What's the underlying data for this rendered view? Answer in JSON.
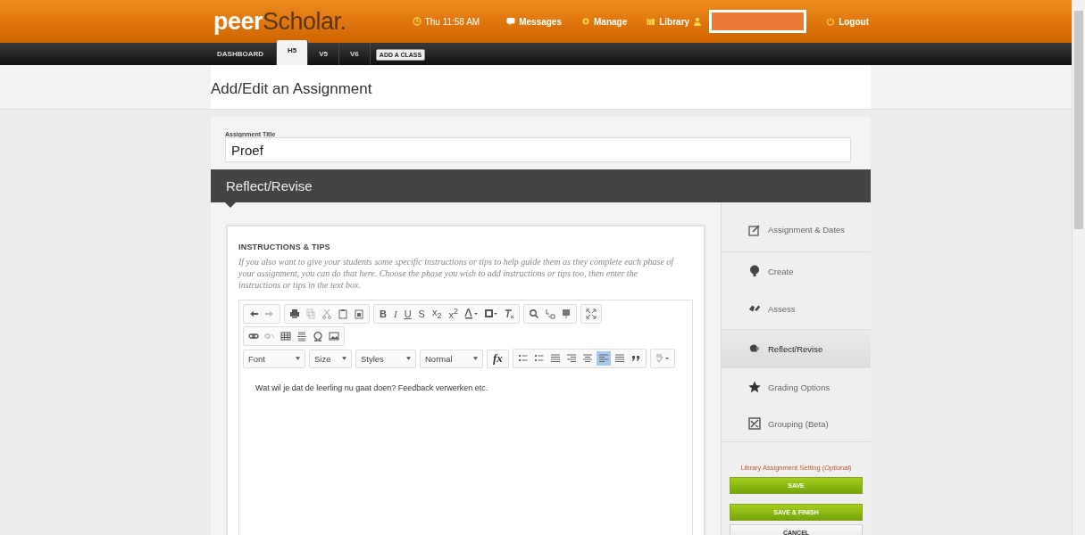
{
  "header": {
    "logo_part1": "peer",
    "logo_part2": "Scholar.",
    "time": "Thu 11:58 AM",
    "links": [
      {
        "label": "Messages"
      },
      {
        "label": "Manage"
      },
      {
        "label": "Library"
      }
    ],
    "logout": "Logout"
  },
  "class_tabs": [
    {
      "label": "DASHBOARD",
      "selected": false
    },
    {
      "label": "H5",
      "selected": true
    },
    {
      "label": "V5",
      "selected": false
    },
    {
      "label": "V6",
      "selected": false
    }
  ],
  "add_class": "ADD A CLASS",
  "page_title": "Add/Edit an Assignment",
  "assignment_title": {
    "label": "Assignment Title",
    "value": "Proef"
  },
  "phase_bar": "Reflect/Revise",
  "instructions": {
    "heading": "INSTRUCTIONS & TIPS",
    "text": "If you also want to give your students some specific instructions or tips to help guide them as they complete each phase of your assignment, you can do that here. Choose the phase you wish to add instructions or tips too, then enter the instructions or tips in the text box."
  },
  "editor": {
    "format_buttons": [
      "B",
      "I",
      "U",
      "S",
      "x$_{2}$",
      "x$^{2}$"
    ],
    "dropdowns": [
      "Font",
      "Size",
      "Styles",
      "Normal"
    ],
    "formula": "fx",
    "paragraph_buttons": [
      {
        "selected": false
      },
      {
        "selected": false
      },
      {
        "selected": false
      },
      {
        "selected": false
      },
      {
        "selected": false
      },
      {
        "selected": true
      },
      {
        "selected": false
      },
      {
        "selected": false
      }
    ],
    "content": "Wat wil je dat de leerling nu gaat doen? Feedback verwerken etc."
  },
  "phases": [
    {
      "label": "Assignment & Dates",
      "selected": false
    },
    {
      "label": "Create",
      "selected": false
    },
    {
      "label": "Assess",
      "selected": false
    },
    {
      "label": "Reflect/Revise",
      "selected": true
    },
    {
      "label": "Grading Options",
      "selected": false
    },
    {
      "label": "Grouping (Beta)",
      "selected": false
    }
  ],
  "library_setting": "Library Assignment Setting (Optional)",
  "buttons": [
    {
      "label": "SAVE",
      "kind": "primary"
    },
    {
      "label": "SAVE & FINISH",
      "kind": "primary"
    },
    {
      "label": "CANCEL",
      "kind": "secondary"
    }
  ]
}
